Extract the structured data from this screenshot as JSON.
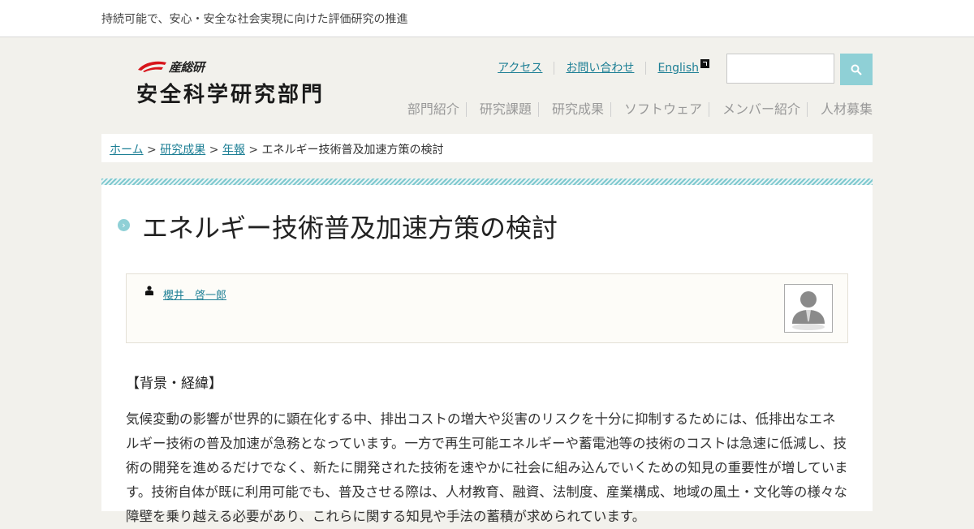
{
  "header": {
    "tagline": "持続可能で、安心・安全な社会実現に向けた評価研究の推進",
    "logo_org": "産総研",
    "logo_dept": "安全科学研究部門"
  },
  "utility_nav": [
    {
      "label": "アクセス"
    },
    {
      "label": "お問い合わせ"
    },
    {
      "label": "English"
    }
  ],
  "search": {
    "placeholder": ""
  },
  "main_nav": [
    {
      "label": "部門紹介"
    },
    {
      "label": "研究課題"
    },
    {
      "label": "研究成果"
    },
    {
      "label": "ソフトウェア"
    },
    {
      "label": "メンバー紹介"
    },
    {
      "label": "人材募集"
    }
  ],
  "breadcrumb": {
    "items": [
      "ホーム",
      "研究成果",
      "年報"
    ],
    "current": "エネルギー技術普及加速方策の検討",
    "separator": ">"
  },
  "article": {
    "title": "エネルギー技術普及加速方策の検討",
    "author": "櫻井　啓一郎",
    "section_heading": "【背景・経緯】",
    "body": "気候変動の影響が世界的に顕在化する中、排出コストの増大や災害のリスクを十分に抑制するためには、低排出なエネルギー技術の普及加速が急務となっています。一方で再生可能エネルギーや蓄電池等の技術のコストは急速に低減し、技術の開発を進めるだけでなく、新たに開発された技術を速やかに社会に組み込んでいくための知見の重要性が増しています。技術自体が既に利用可能でも、普及させる際は、人材教育、融資、法制度、産業構成、地域の風土・文化等の様々な障壁を乗り越える必要があり、これらに関する知見や手法の蓄積が求められています。"
  },
  "colors": {
    "accent": "#8fd0d6",
    "link": "#1d7f95",
    "background": "#f2f1ec"
  }
}
